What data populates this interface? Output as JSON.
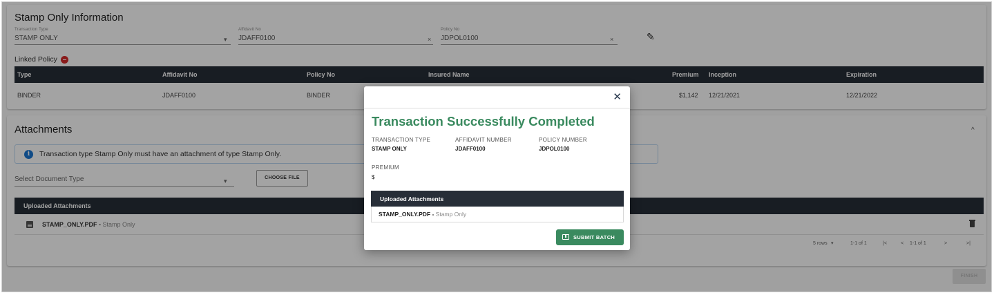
{
  "stamp_info": {
    "title": "Stamp Only Information",
    "transaction_type_label": "Transaction Type",
    "transaction_type_value": "STAMP ONLY",
    "affidavit_label": "Affidavit No",
    "affidavit_value": "JDAFF0100",
    "policy_label": "Policy No",
    "policy_value": "JDPOL0100",
    "linked_policy_label": "Linked Policy",
    "table_headers": [
      "Type",
      "Affidavit No",
      "Policy No",
      "Insured Name",
      "Premium",
      "Inception",
      "Expiration"
    ],
    "table_rows": [
      {
        "type": "BINDER",
        "affidavit": "JDAFF0100",
        "policy": "BINDER",
        "insured": "",
        "premium": "$1,142",
        "inception": "12/21/2021",
        "expiration": "12/21/2022"
      }
    ]
  },
  "attachments": {
    "title": "Attachments",
    "info_text": "Transaction type Stamp Only must have an attachment of type Stamp Only.",
    "select_placeholder": "Select Document Type",
    "choose_file_label": "CHOOSE FILE",
    "uploaded_header": "Uploaded Attachments",
    "files": [
      {
        "name": "STAMP_ONLY.PDF",
        "type": "Stamp Only"
      }
    ],
    "pager": {
      "rows": "5 rows",
      "range": "1-1 of 1",
      "first": "|<",
      "prev": "<",
      "page": "1-1 of 1",
      "next": ">",
      "last": ">|"
    },
    "finish_label": "FINISH"
  },
  "modal": {
    "close": "✕",
    "title": "Transaction Successfully Completed",
    "transaction_type_label": "TRANSACTION TYPE",
    "transaction_type_value": "STAMP ONLY",
    "affidavit_label": "AFFIDAVIT NUMBER",
    "affidavit_value": "JDAFF0100",
    "policy_label": "POLICY NUMBER",
    "policy_value": "JDPOL0100",
    "premium_label": "PREMIUM",
    "premium_value": "$",
    "uploaded_header": "Uploaded Attachments",
    "file_name": "STAMP_ONLY.PDF",
    "file_type": "Stamp Only",
    "submit_label": "SUBMIT BATCH"
  },
  "icons": {
    "clear": "×",
    "dropdown": "▾",
    "edit": "✎",
    "collapse": "^",
    "info": "i"
  },
  "colors": {
    "table_header": "#272e38",
    "success_green": "#3a8a5f",
    "info_blue": "#1976d2",
    "remove_red": "#d62b2b"
  }
}
